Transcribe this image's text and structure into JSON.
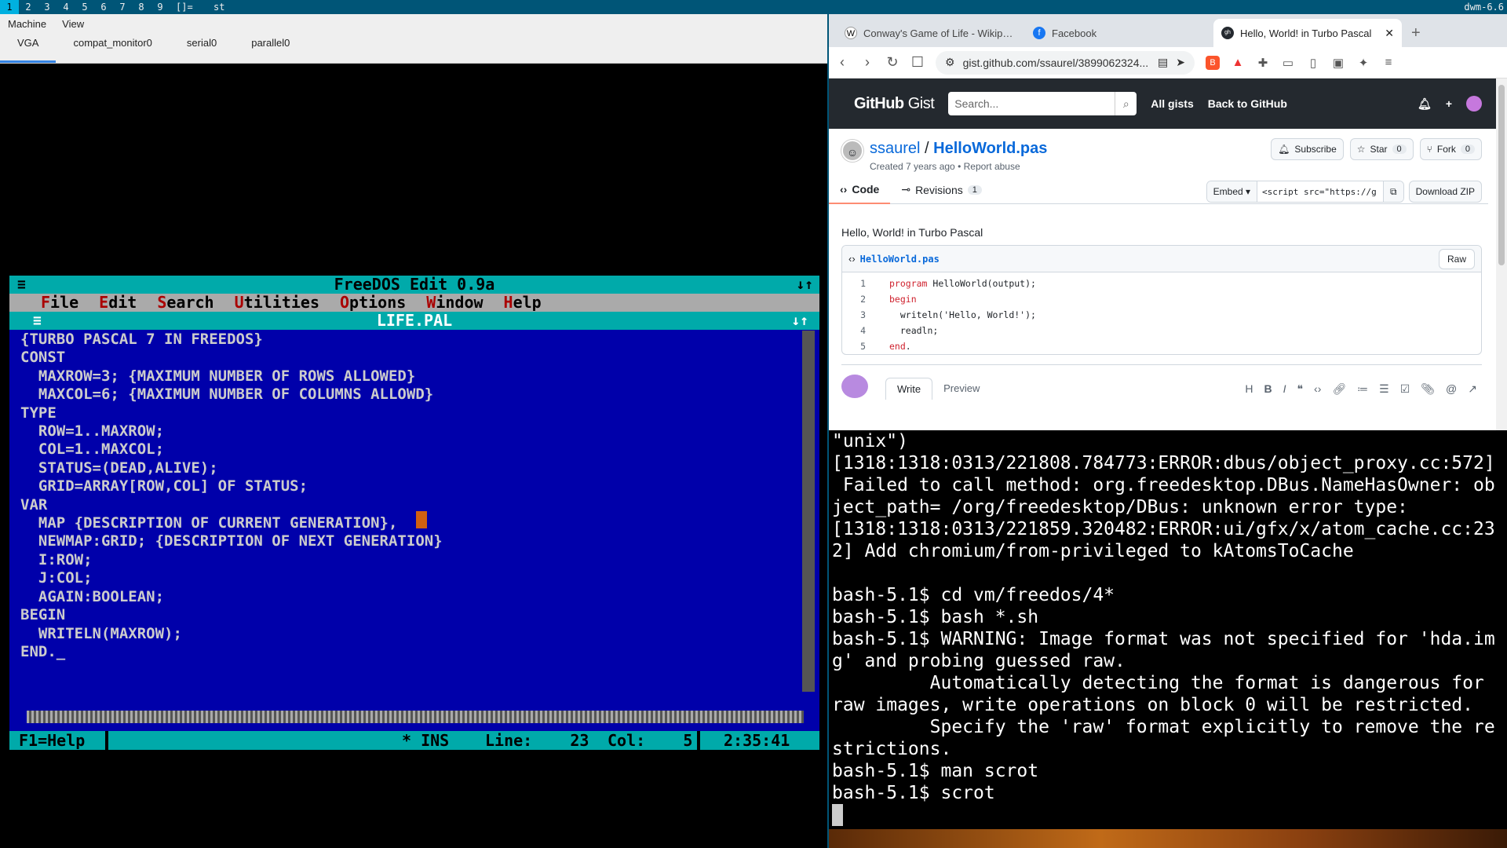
{
  "dwm": {
    "tags": [
      "1",
      "2",
      "3",
      "4",
      "5",
      "6",
      "7",
      "8",
      "9"
    ],
    "layout": "[]=",
    "title": "st",
    "status": "dwm-6.6"
  },
  "qemu": {
    "menu": [
      "Machine",
      "View"
    ],
    "tabs": [
      "VGA",
      "compat_monitor0",
      "serial0",
      "parallel0"
    ]
  },
  "edit": {
    "app_title": "FreeDOS Edit 0.9a",
    "menus": [
      {
        "hot": "F",
        "rest": "ile"
      },
      {
        "hot": "E",
        "rest": "dit"
      },
      {
        "hot": "S",
        "rest": "earch"
      },
      {
        "hot": "U",
        "rest": "tilities"
      },
      {
        "hot": "O",
        "rest": "ptions"
      },
      {
        "hot": "W",
        "rest": "indow"
      },
      {
        "hot": "H",
        "rest": "elp"
      }
    ],
    "doc_title": "LIFE.PAL",
    "code_lines": [
      "{TURBO PASCAL 7 IN FREEDOS}",
      "",
      "CONST",
      "  MAXROW=3; {MAXIMUM NUMBER OF ROWS ALLOWED}",
      "  MAXCOL=6; {MAXIMUM NUMBER OF COLUMNS ALLOWD}",
      "TYPE",
      "  ROW=1..MAXROW;",
      "  COL=1..MAXCOL;",
      "  STATUS=(DEAD,ALIVE);",
      "  GRID=ARRAY[ROW,COL] OF STATUS;",
      "VAR",
      "  MAP {DESCRIPTION OF CURRENT GENERATION},",
      "  NEWMAP:GRID; {DESCRIPTION OF NEXT GENERATION}",
      "  I:ROW;",
      "  J:COL;",
      "  AGAIN:BOOLEAN;",
      "",
      "BEGIN",
      "  WRITELN(MAXROW);",
      "END._"
    ],
    "status": {
      "help": "F1=Help",
      "ins": "* INS",
      "line_label": "Line:",
      "line": "23",
      "col_label": "Col:",
      "col": "5",
      "time": "2:35:41"
    }
  },
  "browser": {
    "tabs": [
      {
        "icon": "W",
        "title": "Conway's Game of Life - Wikipedia"
      },
      {
        "icon": "f",
        "title": "Facebook"
      },
      {
        "icon": "gh",
        "title": "Hello, World! in Turbo Pascal"
      }
    ],
    "url": "gist.github.com/ssaurel/3899062324...",
    "gh": {
      "logo_main": "GitHub",
      "logo_sub": "Gist",
      "search_placeholder": "Search...",
      "all_gists": "All gists",
      "back": "Back to GitHub"
    },
    "gist": {
      "owner": "ssaurel",
      "sep": "/",
      "file": "HelloWorld.pas",
      "meta": "Created 7 years ago • Report abuse",
      "subscribe": "Subscribe",
      "star": "Star",
      "star_count": "0",
      "fork": "Fork",
      "fork_count": "0",
      "tab_code": "Code",
      "tab_revisions": "Revisions",
      "revisions_count": "1",
      "embed": "Embed",
      "embed_code": "<script src=\"https://g",
      "download": "Download ZIP",
      "description": "Hello, World! in Turbo Pascal",
      "filename": "HelloWorld.pas",
      "raw": "Raw",
      "lines": [
        {
          "n": "1",
          "kw": "program",
          "rest": " HelloWorld(output);"
        },
        {
          "n": "2",
          "kw": "begin",
          "rest": ""
        },
        {
          "n": "3",
          "kw": "",
          "rest": "  writeln('Hello, World!');"
        },
        {
          "n": "4",
          "kw": "",
          "rest": "  readln;"
        },
        {
          "n": "5",
          "kw": "end",
          "rest": "."
        }
      ],
      "write": "Write",
      "preview": "Preview"
    }
  },
  "terminal": {
    "lines": [
      "\"unix\")",
      "[1318:1318:0313/221808.784773:ERROR:dbus/object_proxy.cc:572]",
      " Failed to call method: org.freedesktop.DBus.NameHasOwner: ob",
      "ject_path= /org/freedesktop/DBus: unknown error type:",
      "[1318:1318:0313/221859.320482:ERROR:ui/gfx/x/atom_cache.cc:23",
      "2] Add chromium/from-privileged to kAtomsToCache",
      "",
      "bash-5.1$ cd vm/freedos/4*",
      "bash-5.1$ bash *.sh",
      "bash-5.1$ WARNING: Image format was not specified for 'hda.im",
      "g' and probing guessed raw.",
      "         Automatically detecting the format is dangerous for",
      "raw images, write operations on block 0 will be restricted.",
      "         Specify the 'raw' format explicitly to remove the re",
      "strictions.",
      "bash-5.1$ man scrot",
      "bash-5.1$ scrot"
    ]
  }
}
